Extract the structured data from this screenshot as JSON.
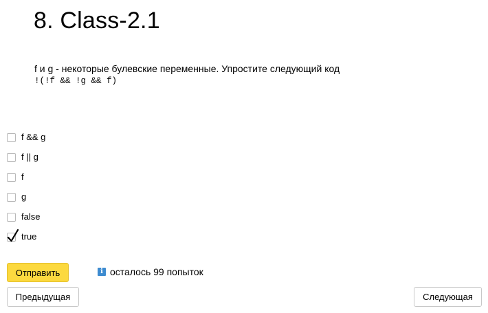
{
  "header": {
    "title": "8. Class-2.1"
  },
  "question": {
    "text": "f и g - некоторые булевские переменные. Упростите следующий код",
    "code": "!(!f && !g && f)"
  },
  "options": [
    {
      "label": "f && g",
      "checked": false
    },
    {
      "label": "f || g",
      "checked": false
    },
    {
      "label": "f",
      "checked": false
    },
    {
      "label": "g",
      "checked": false
    },
    {
      "label": "false",
      "checked": false
    },
    {
      "label": "true",
      "checked": true
    }
  ],
  "actions": {
    "submit_label": "Отправить",
    "attempts_text": "осталось 99 попыток",
    "prev_label": "Предыдущая",
    "next_label": "Следующая"
  },
  "icons": {
    "info": "info-icon",
    "checkmark": "checkmark-icon"
  },
  "colors": {
    "submit_bg": "#fcd93f",
    "info_icon": "#3d8bd0"
  }
}
